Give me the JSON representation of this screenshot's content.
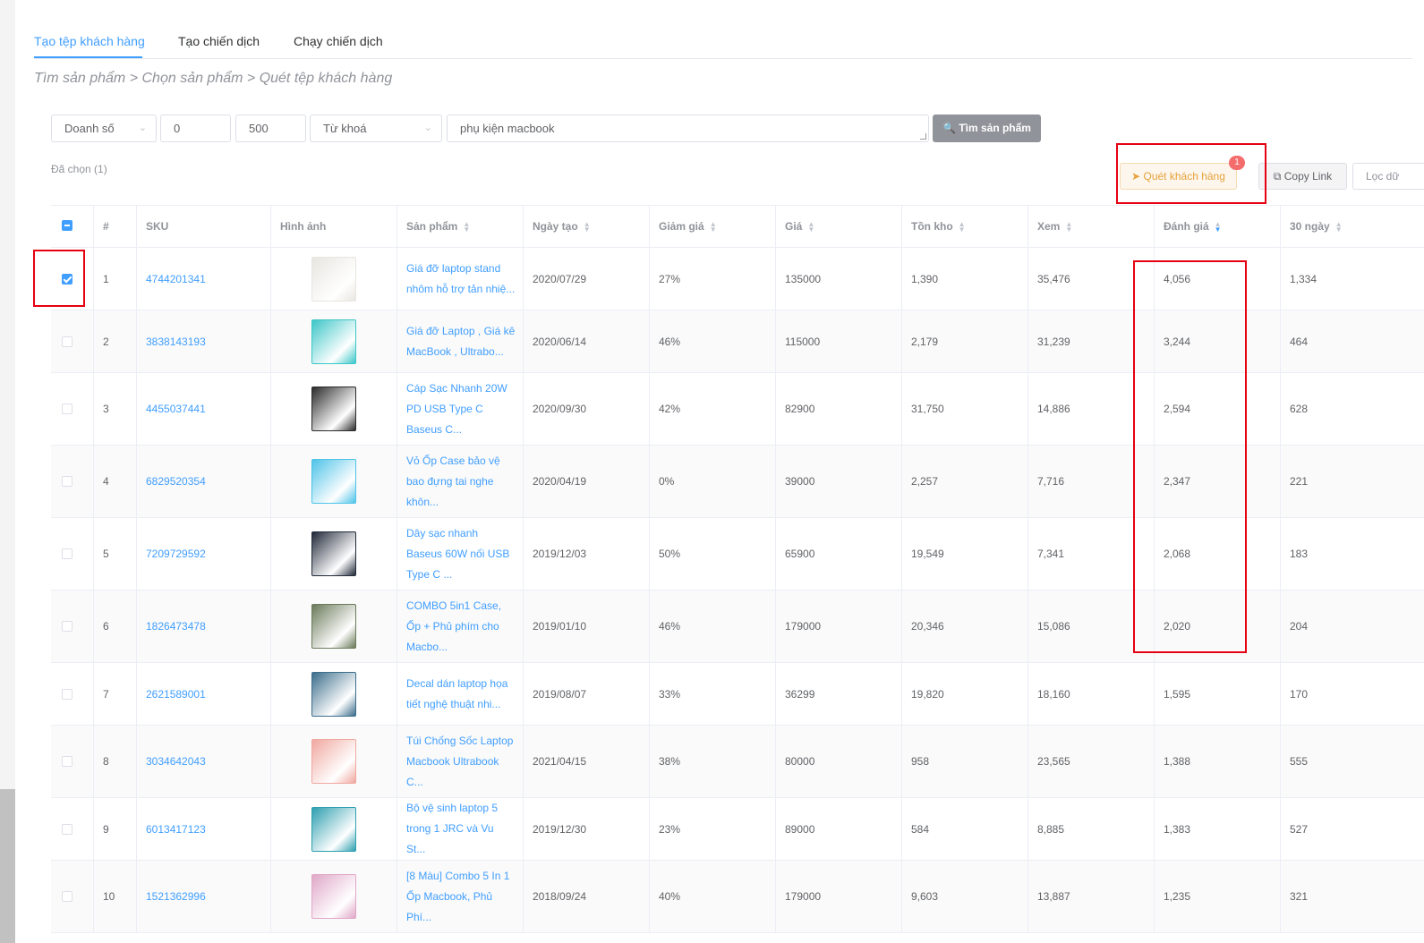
{
  "tabs": [
    {
      "label": "Tạo tệp khách hàng",
      "active": true
    },
    {
      "label": "Tạo chiến dịch",
      "active": false
    },
    {
      "label": "Chạy chiến dịch",
      "active": false
    }
  ],
  "breadcrumb": "Tìm sản phẩm > Chọn sản phẩm > Quét tệp khách hàng",
  "filters": {
    "metric": "Doanh số",
    "min": "0",
    "max": "500",
    "mode": "Từ khoá",
    "keyword": "phụ kiện macbook",
    "search_label": "Tìm sản phẩm"
  },
  "selected_count": "Đã chọn (1)",
  "actions": {
    "scan_label": "Quét khách hàng",
    "scan_badge": "1",
    "copy_label": "Copy Link",
    "filter_label": "Lọc dữ"
  },
  "columns": [
    "#",
    "SKU",
    "Hình ảnh",
    "Sản phẩm",
    "Ngày tạo",
    "Giảm giá",
    "Giá",
    "Tồn kho",
    "Xem",
    "Đánh giá",
    "30 ngày"
  ],
  "rows": [
    {
      "n": "1",
      "sku": "4744201341",
      "name": "Giá đỡ laptop stand nhôm hỗ trợ tản nhiệ...",
      "date": "2020/07/29",
      "discount": "27%",
      "price": "135000",
      "stock": "1,390",
      "views": "35,476",
      "rating": "4,056",
      "d30": "1,334",
      "checked": true,
      "thumb": "#e8e6e0"
    },
    {
      "n": "2",
      "sku": "3838143193",
      "name": "Giá đỡ Laptop , Giá kê MacBook , Ultrabo...",
      "date": "2020/06/14",
      "discount": "46%",
      "price": "115000",
      "stock": "2,179",
      "views": "31,239",
      "rating": "3,244",
      "d30": "464",
      "checked": false,
      "thumb": "#3ec6c8"
    },
    {
      "n": "3",
      "sku": "4455037441",
      "name": "Cáp Sạc Nhanh 20W PD USB Type C Baseus C...",
      "date": "2020/09/30",
      "discount": "42%",
      "price": "82900",
      "stock": "31,750",
      "views": "14,886",
      "rating": "2,594",
      "d30": "628",
      "checked": false,
      "thumb": "#2b2b2b"
    },
    {
      "n": "4",
      "sku": "6829520354",
      "name": "Vỏ Ốp Case bảo vệ bao đựng tai nghe khôn...",
      "date": "2020/04/19",
      "discount": "0%",
      "price": "39000",
      "stock": "2,257",
      "views": "7,716",
      "rating": "2,347",
      "d30": "221",
      "checked": false,
      "thumb": "#4fc3e8"
    },
    {
      "n": "5",
      "sku": "7209729592",
      "name": "Dây sạc nhanh Baseus 60W nối USB Type C ...",
      "date": "2019/12/03",
      "discount": "50%",
      "price": "65900",
      "stock": "19,549",
      "views": "7,341",
      "rating": "2,068",
      "d30": "183",
      "checked": false,
      "thumb": "#222a3a"
    },
    {
      "n": "6",
      "sku": "1826473478",
      "name": "COMBO 5in1 Case, Ốp + Phủ phím cho Macbo...",
      "date": "2019/01/10",
      "discount": "46%",
      "price": "179000",
      "stock": "20,346",
      "views": "15,086",
      "rating": "2,020",
      "d30": "204",
      "checked": false,
      "thumb": "#6b7a5a"
    },
    {
      "n": "7",
      "sku": "2621589001",
      "name": "Decal dán laptop họa tiết nghệ thuật nhi...",
      "date": "2019/08/07",
      "discount": "33%",
      "price": "36299",
      "stock": "19,820",
      "views": "18,160",
      "rating": "1,595",
      "d30": "170",
      "checked": false,
      "thumb": "#3c6e8c"
    },
    {
      "n": "8",
      "sku": "3034642043",
      "name": "Túi Chống Sốc Laptop Macbook Ultrabook C...",
      "date": "2021/04/15",
      "discount": "38%",
      "price": "80000",
      "stock": "958",
      "views": "23,565",
      "rating": "1,388",
      "d30": "555",
      "checked": false,
      "thumb": "#f0a8a0"
    },
    {
      "n": "9",
      "sku": "6013417123",
      "name": "Bộ vệ sinh laptop 5 trong 1 JRC và Vu St...",
      "date": "2019/12/30",
      "discount": "23%",
      "price": "89000",
      "stock": "584",
      "views": "8,885",
      "rating": "1,383",
      "d30": "527",
      "checked": false,
      "thumb": "#2e9fb0"
    },
    {
      "n": "10",
      "sku": "1521362996",
      "name": "[8 Màu] Combo 5 In 1 Ốp Macbook, Phủ Phí...",
      "date": "2018/09/24",
      "discount": "40%",
      "price": "179000",
      "stock": "9,603",
      "views": "13,887",
      "rating": "1,235",
      "d30": "321",
      "checked": false,
      "thumb": "#e0a8c8"
    }
  ]
}
